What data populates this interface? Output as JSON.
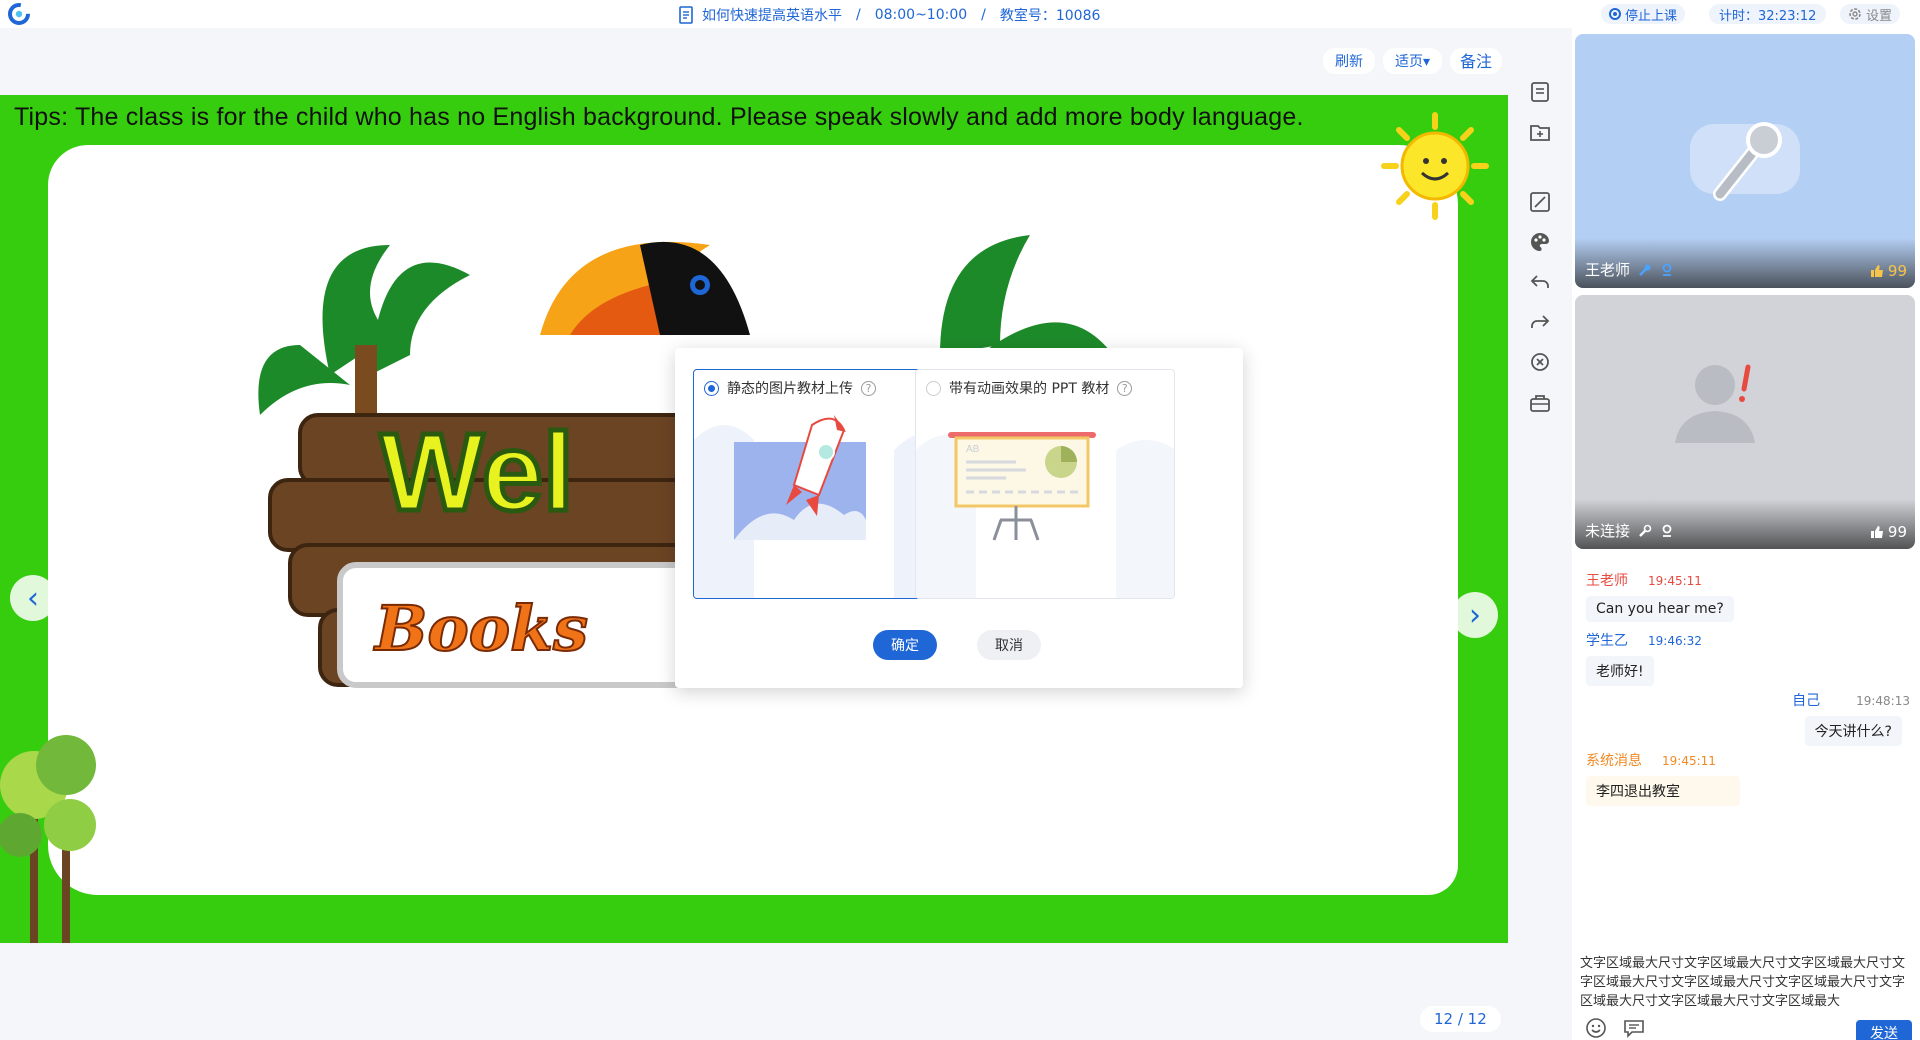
{
  "header": {
    "course_title": "如何快速提高英语水平",
    "time_range": "08:00~10:00",
    "classroom": "教室号：10086",
    "separator": "/",
    "stop_label": "停止上课",
    "timer": "计时：32:23:12",
    "settings_label": "设置"
  },
  "toolbar": {
    "refresh": "刷新",
    "fit": "适页▾",
    "notes": "备注"
  },
  "slide": {
    "tips": "Tips: The class is for the child who has no English background. Please speak slowly and add more body language.",
    "pager": "12 / 12"
  },
  "modal": {
    "option1": "静态的图片教材上传",
    "option2": "带有动画效果的 PPT 教材",
    "help": "?",
    "ok": "确定",
    "cancel": "取消"
  },
  "videos": {
    "teacher_name": "王老师",
    "teacher_likes": "99",
    "student_name": "未连接",
    "student_likes": "99"
  },
  "chat": {
    "m1_who": "王老师",
    "m1_time": "19:45:11",
    "m1_text": "Can you hear me?",
    "m2_who": "学生乙",
    "m2_time": "19:46:32",
    "m2_text": "老师好!",
    "m3_who": "自己",
    "m3_time": "19:48:13",
    "m3_text": "今天讲什么?",
    "m4_who": "系统消息",
    "m4_time": "19:45:11",
    "m4_text": "李四退出教室"
  },
  "input": {
    "text": "文字区域最大尺寸文字区域最大尺寸文字区域最大尺寸文字区域最大尺寸文字区域最大尺寸文字区域最大尺寸文字区域最大尺寸文字区域最大尺寸文字区域最大",
    "send": "发送"
  },
  "colors": {
    "accent": "#1f66d6",
    "slide_green": "#37cd0f",
    "teacher_red": "#e84a3f",
    "student_blue": "#1f66d6",
    "system_orange": "#f08a24"
  }
}
